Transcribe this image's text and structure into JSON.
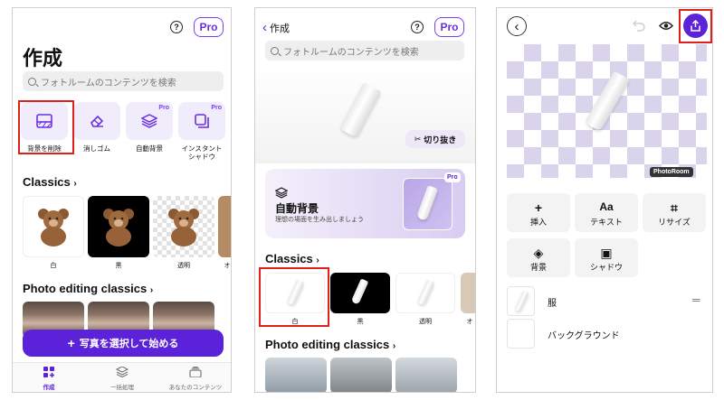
{
  "screen1": {
    "help_glyph": "?",
    "pro_label": "Pro",
    "title": "作成",
    "search_placeholder": "フォトルームのコンテンツを検索",
    "tools": [
      {
        "label": "背景を削除",
        "pro": false,
        "icon": "remove-bg-icon"
      },
      {
        "label": "消しゴム",
        "pro": false,
        "icon": "eraser-icon"
      },
      {
        "label": "自動背景",
        "pro": true,
        "icon": "layers-icon"
      },
      {
        "label": "インスタント\nシャドウ",
        "pro": true,
        "icon": "shadow-icon"
      }
    ],
    "pro_badge": "Pro",
    "classics_title": "Classics",
    "classics": [
      "白",
      "黒",
      "透明",
      "オ"
    ],
    "photo_editing_title": "Photo editing classics",
    "cta_label": "写真を選択して始める",
    "cta_plus": "+",
    "tabs": [
      "作成",
      "一括処理",
      "あなたのコンテンツ"
    ]
  },
  "screen2": {
    "back_label": "作成",
    "help_glyph": "?",
    "pro_label": "Pro",
    "search_placeholder": "フォトルームのコンテンツを検索",
    "cutout_label": "切り抜き",
    "banner_title": "自動背景",
    "banner_subtitle": "理想の場面を生み出しましょう",
    "banner_pro": "Pro",
    "classics_title": "Classics",
    "classics": [
      "白",
      "黒",
      "透明",
      "オ"
    ],
    "photo_editing_title": "Photo editing classics"
  },
  "screen3": {
    "watermark": "PhotoRoom",
    "options_row1": [
      {
        "symbol": "+",
        "label": "挿入",
        "icon": "plus-icon"
      },
      {
        "symbol": "Aa",
        "label": "テキスト",
        "icon": "text-icon"
      },
      {
        "symbol": "⌗",
        "label": "リサイズ",
        "icon": "crop-icon"
      }
    ],
    "options_row2": [
      {
        "symbol": "◈",
        "label": "背景",
        "icon": "layers-icon"
      },
      {
        "symbol": "▣",
        "label": "シャドウ",
        "icon": "shadow-icon"
      }
    ],
    "layers": [
      "服",
      "バックグラウンド"
    ],
    "drag_handle": "═"
  },
  "colors": {
    "accent": "#5b22d9",
    "highlight_red": "#e0201b",
    "checker_purple": "#d9d4ec"
  }
}
